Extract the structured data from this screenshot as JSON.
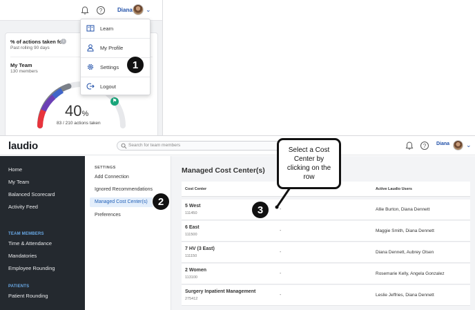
{
  "top": {
    "user_name": "Diana",
    "widget": {
      "title": "% of actions taken for",
      "subtitle": "Past rolling 90 days",
      "team_label": "My Team",
      "members": "130 members",
      "percent": "40",
      "percent_sign": "%",
      "actions": "83 / 210 actions taken",
      "progress": 0.4
    },
    "menu": [
      {
        "label": "Learn",
        "icon": "book-icon"
      },
      {
        "label": "My Profile",
        "icon": "person-icon"
      },
      {
        "label": "Settings",
        "icon": "gear-icon"
      },
      {
        "label": "Logout",
        "icon": "logout-icon"
      }
    ]
  },
  "badges": [
    "1",
    "2",
    "3"
  ],
  "app": {
    "logo": "laudio",
    "search_placeholder": "Search for team members",
    "user_name": "Diana",
    "sidebar": {
      "items": [
        "Home",
        "My Team",
        "Balanced Scorecard",
        "Activity Feed"
      ],
      "section_team": "TEAM MEMBERS",
      "team_items": [
        "Time & Attendance",
        "Mandatories",
        "Employee Rounding"
      ],
      "section_patients": "PATIENTS",
      "patient_items": [
        "Patient Rounding"
      ]
    },
    "settings": {
      "heading": "SETTINGS",
      "items": [
        "Add Connection",
        "Ignored Recommendations",
        "Managed Cost Center(s)",
        "Preferences"
      ],
      "active_index": 2
    },
    "main": {
      "title": "Managed Cost Center(s)",
      "columns": [
        "Cost Center",
        "Active Laudio Users"
      ],
      "rows": [
        {
          "name": "5 West",
          "code": "111450",
          "dash": "-",
          "users": "Allie Burton, Diana Dennett"
        },
        {
          "name": "6 East",
          "code": "111500",
          "dash": "-",
          "users": "Maggie Smith, Diana Dennett"
        },
        {
          "name": "7 HV (3 East)",
          "code": "111150",
          "dash": "-",
          "users": "Diana Dennett, Aubrey Olsen"
        },
        {
          "name": "2 Women",
          "code": "113100",
          "dash": "-",
          "users": "Rosemarie Kelly, Angela Gonzalez"
        },
        {
          "name": "Surgery Inpatient Management",
          "code": "275412",
          "dash": "-",
          "users": "Leslie Jeffries, Diana Dennett"
        }
      ]
    }
  },
  "callout": {
    "lines": [
      "Select a Cost",
      "Center by",
      "clicking on the",
      "row"
    ]
  },
  "colors": {
    "accent": "#1f4fa8",
    "sidebar_bg": "#24292f",
    "section_blue": "#69a9e6",
    "active_bg": "#e3eefb",
    "gauge_green": "#19a57a"
  }
}
